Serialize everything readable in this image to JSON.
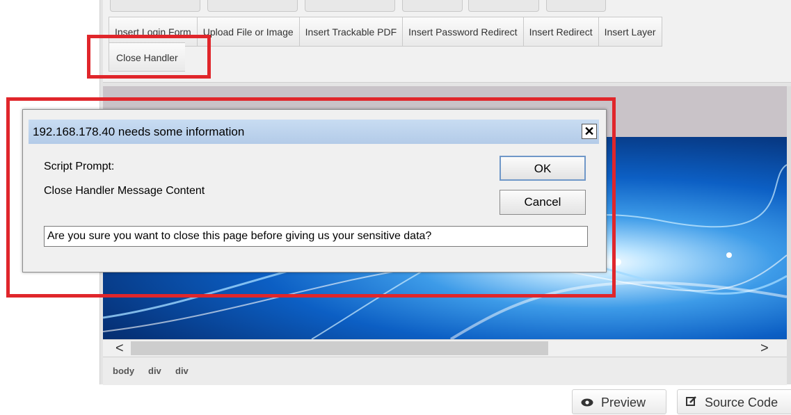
{
  "toolbar": {
    "buttons": [
      "Insert Login Form",
      "Upload File or Image",
      "Insert Trackable PDF",
      "Insert Password Redirect",
      "Insert Redirect",
      "Insert Layer"
    ],
    "close_handler": "Close Handler"
  },
  "path_bar": [
    "body",
    "div",
    "div"
  ],
  "dialog": {
    "title": "192.168.178.40 needs some information",
    "close_glyph": "✕",
    "label_script_prompt": "Script Prompt:",
    "label_message": "Close Handler Message Content",
    "ok_label": "OK",
    "cancel_label": "Cancel",
    "input_value": "Are you sure you want to close this page before giving us your sensitive data?"
  },
  "bottom": {
    "preview_label": "Preview",
    "source_label": "Source Code"
  },
  "scroll": {
    "left_arrow": "<",
    "right_arrow": ">"
  },
  "colors": {
    "highlight": "#e0262b",
    "dialog_title_bar": "#b3cbe8"
  }
}
